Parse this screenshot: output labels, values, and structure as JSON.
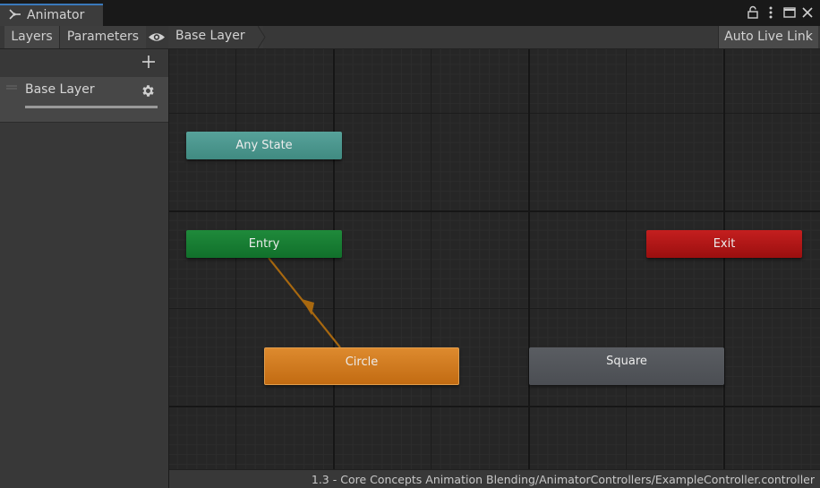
{
  "window": {
    "tab_title": "Animator",
    "tab_icon": "animator-icon",
    "lock_icon": "lock-icon",
    "menu_icon": "more-vert-icon",
    "maximize_icon": "maximize-icon",
    "close_icon": "close-icon"
  },
  "toolbar": {
    "layers_tab": "Layers",
    "parameters_tab": "Parameters",
    "eye_icon": "eye-icon",
    "breadcrumb": "Base Layer",
    "auto_live_link": "Auto Live Link"
  },
  "layers_panel": {
    "add_icon": "plus-icon",
    "layers": [
      {
        "name": "Base Layer",
        "weight": 1.0
      }
    ]
  },
  "graph": {
    "states": {
      "any_state": {
        "label": "Any State",
        "color": "#4a968e"
      },
      "entry": {
        "label": "Entry",
        "color": "#177d33"
      },
      "exit": {
        "label": "Exit",
        "color": "#b01717"
      },
      "circle": {
        "label": "Circle",
        "color": "#d07a20",
        "is_default": true
      },
      "square": {
        "label": "Square",
        "color": "#53565b"
      }
    },
    "transitions": [
      {
        "from": "Entry",
        "to": "Circle",
        "color": "#b06d0f"
      }
    ]
  },
  "status": {
    "path": "1.3 - Core Concepts Animation Blending/AnimatorControllers/ExampleController.controller"
  }
}
